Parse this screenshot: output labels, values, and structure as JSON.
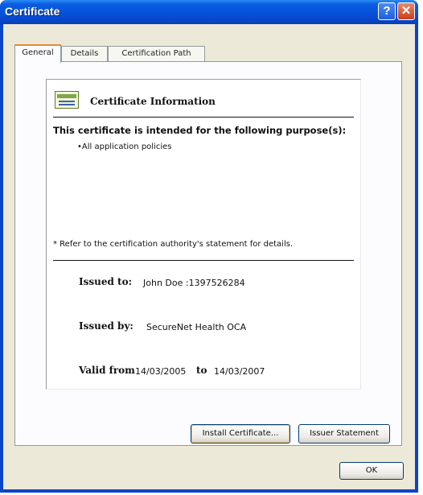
{
  "window": {
    "title": "Certificate",
    "help_label": "?",
    "close_label": "✕"
  },
  "tabs": [
    {
      "label": "General",
      "active": true
    },
    {
      "label": "Details",
      "active": false
    },
    {
      "label": "Certification Path",
      "active": false
    }
  ],
  "general": {
    "header": "Certificate Information",
    "purpose_heading": "This certificate is intended for the following purpose(s):",
    "purposes": [
      "•All application policies"
    ],
    "refer_note": "* Refer to the certification authority's statement for details.",
    "issued_to_label": "Issued to:",
    "issued_to_value": "John Doe :1397526284",
    "issued_by_label": "Issued by:",
    "issued_by_value": "SecureNet Health OCA",
    "valid_from_label": "Valid from",
    "valid_from_value": "14/03/2005",
    "valid_to_label": "to",
    "valid_to_value": "14/03/2007"
  },
  "buttons": {
    "install": "Install Certificate...",
    "issuer": "Issuer Statement",
    "ok": "OK"
  },
  "icons": {
    "certificate": "certificate-icon",
    "help": "help-icon",
    "close": "close-icon"
  },
  "colors": {
    "titlebar": "#0654dc",
    "frame": "#0a44c8",
    "dialog_bg": "#ece9d8",
    "tab_highlight": "#e68b2c"
  }
}
